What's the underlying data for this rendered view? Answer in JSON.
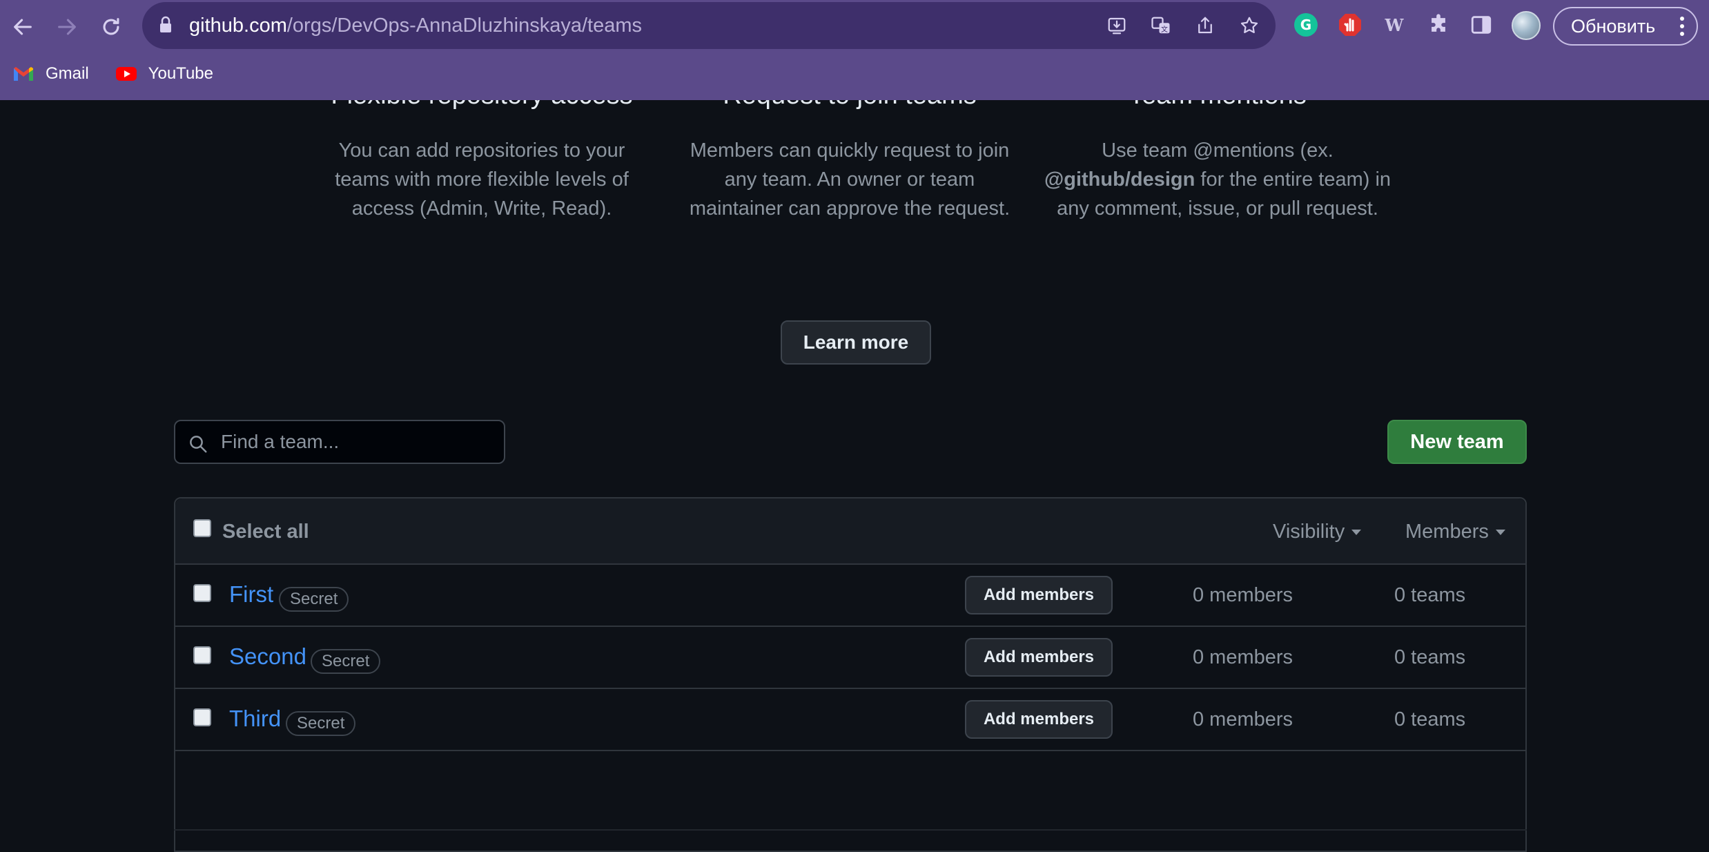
{
  "browser": {
    "url_host": "github.com",
    "url_path": "/orgs/DevOps-AnnaDluzhinskaya/teams",
    "update_label": "Обновить",
    "bookmarks": [
      {
        "label": "Gmail",
        "icon": "gmail-icon"
      },
      {
        "label": "YouTube",
        "icon": "youtube-icon"
      }
    ]
  },
  "features": [
    {
      "title": "Flexible repository access",
      "desc": "You can add repositories to your teams with more flexible levels of access (Admin, Write, Read)."
    },
    {
      "title": "Request to join teams",
      "desc": "Members can quickly request to join any team. An owner or team maintainer can approve the request."
    },
    {
      "title": "Team mentions",
      "desc_before": "Use team @mentions (ex. ",
      "desc_bold": "@github/design",
      "desc_after": " for the entire team) in any comment, issue, or pull request."
    }
  ],
  "learn_more_label": "Learn more",
  "search": {
    "placeholder": "Find a team..."
  },
  "new_team_label": "New team",
  "table": {
    "select_all_label": "Select all",
    "visibility_label": "Visibility",
    "members_label": "Members",
    "rows": [
      {
        "name": "First",
        "badge": "Secret",
        "add_label": "Add members",
        "members": "0 members",
        "teams": "0 teams"
      },
      {
        "name": "Second",
        "badge": "Secret",
        "add_label": "Add members",
        "members": "0 members",
        "teams": "0 teams"
      },
      {
        "name": "Third",
        "badge": "Secret",
        "add_label": "Add members",
        "members": "0 members",
        "teams": "0 teams"
      }
    ]
  },
  "colors": {
    "chrome_bg": "#5b4a8a",
    "page_bg": "#0d1117",
    "link": "#4493f8",
    "primary_button": "#2f7d3d"
  }
}
